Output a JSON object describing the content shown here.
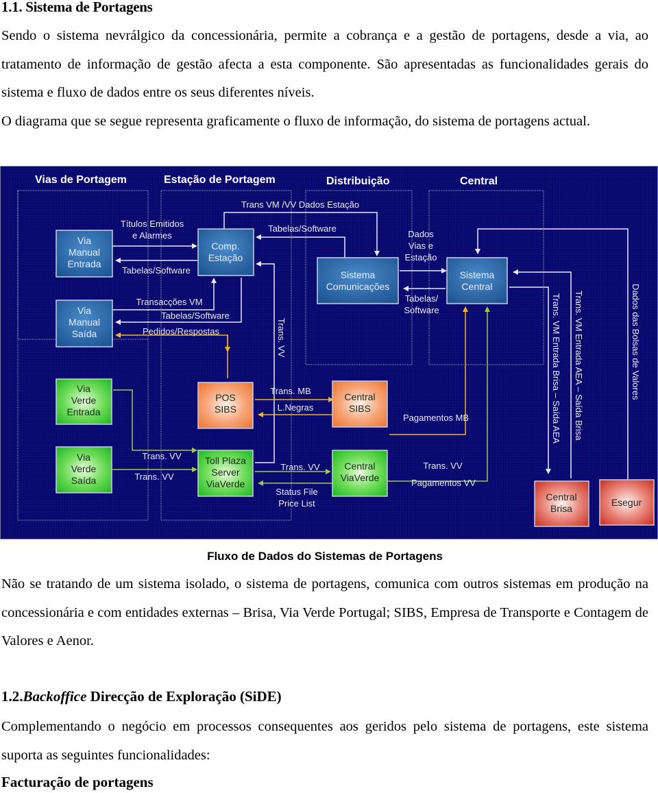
{
  "section1": {
    "heading": "1.1. Sistema de Portagens",
    "paragraph_1": "Sendo o sistema nevrálgico da concessionária, permite a cobrança e a gestão de portagens, desde a via, ao tratamento de informação de gestão afecta a esta componente. São apresentadas as funcionalidades gerais do sistema e fluxo de dados entre os seus diferentes níveis.",
    "paragraph_2": "O diagrama que se segue representa graficamente o fluxo de informação, do sistema de portagens actual."
  },
  "diagram": {
    "colors": {
      "background": "#0a0a6e",
      "blue_box": "#2a63a8",
      "green_box": "#3cc83c",
      "orange_box": "#f0884a",
      "red_box": "#d0463a",
      "line_white": "#e8e8f0",
      "line_yellow": "#f0b420",
      "line_green": "#a0c850"
    },
    "zones": {
      "vias": "Vias de Portagem",
      "estacao": "Estação de Portagem",
      "distribuicao": "Distribuição",
      "central": "Central"
    },
    "nodes": {
      "via_manual_entrada": [
        "Via",
        "Manual",
        "Entrada"
      ],
      "via_manual_saida": [
        "Via",
        "Manual",
        "Saída"
      ],
      "via_verde_entrada": [
        "Via",
        "Verde",
        "Entrada"
      ],
      "via_verde_saida": [
        "Via",
        "Verde",
        "Saída"
      ],
      "comp_estacao": [
        "Comp.",
        "Estação"
      ],
      "pos_sibs": [
        "POS",
        "SIBS"
      ],
      "toll_plaza": [
        "Toll Plaza",
        "Server",
        "ViaVerde"
      ],
      "sistema_comunicacoes": [
        "Sistema",
        "Comunicações"
      ],
      "central_sibs": [
        "Central",
        "SIBS"
      ],
      "central_viaverde": [
        "Central",
        "ViaVerde"
      ],
      "sistema_central": [
        "Sistema",
        "Central"
      ],
      "central_brisa": [
        "Central",
        "Brisa"
      ],
      "esegur": [
        "Esegur"
      ]
    },
    "flows": {
      "titulos": [
        "Títulos Emitidos",
        "e Alarmes"
      ],
      "tabelas_1": "Tabelas/Software",
      "transaccoes_vm": "Transacções VM",
      "tabelas_2": "Tabelas/Software",
      "pedidos": "Pedidos/Respostas",
      "trans_vm_vv": "Trans VM /VV Dados Estação",
      "tabelas_3": "Tabelas/Software",
      "trans_vv_vertical": "Trans. VV",
      "dados_vias": [
        "Dados",
        "Vias e",
        "Estação"
      ],
      "tabelas_4": [
        "Tabelas/",
        "Software"
      ],
      "trans_mb": "Trans. MB",
      "l_negras": "L.Negras",
      "pagamentos_mb": "Pagamentos MB",
      "trans_vv_1": "Trans. VV",
      "trans_vv_2": "Trans. VV",
      "trans_vv_3": "Trans. VV",
      "status_file": [
        "Status File",
        "Price List"
      ],
      "trans_vv_4": "Trans. VV",
      "pagamentos_vv": "Pagamentos VV",
      "trans_vm_brisa_aea": "Trans. VM Entrada Brisa – Saída AEA",
      "trans_vm_aea_brisa": "Trans. VM Entrada AEA – Saída Brisa",
      "dados_bolsas": "Dados das Bolsas de Valores"
    }
  },
  "caption": "Fluxo de Dados do Sistemas de Portagens",
  "paragraph_3": "Não se tratando de um sistema isolado, o sistema de portagens, comunica com outros sistemas em produção na concessionária e com entidades externas – Brisa, Via Verde Portugal; SIBS, Empresa de Transporte e Contagem de Valores e Aenor.",
  "section2": {
    "number": "1.2.",
    "heading_italic": "Backoffice",
    "heading_rest": " Direcção de Exploração (SiDE)",
    "paragraph": "Complementando o negócio em processos consequentes aos geridos pelo sistema de portagens, este sistema suporta as seguintes funcionalidades:",
    "subheading": "Facturação de portagens"
  }
}
